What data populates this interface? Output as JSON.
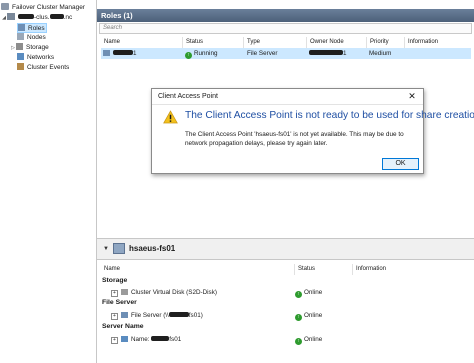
{
  "tree": {
    "root_label": "Failover Cluster Manager",
    "cluster_label_visible": "-clus.",
    "cluster_label_suffix": ".nc",
    "items": [
      {
        "label": "Roles"
      },
      {
        "label": "Nodes"
      },
      {
        "label": "Storage"
      },
      {
        "label": "Networks"
      },
      {
        "label": "Cluster Events"
      }
    ]
  },
  "roles_pane": {
    "title": "Roles (1)",
    "search_placeholder": "Search",
    "columns": [
      "Name",
      "Status",
      "Type",
      "Owner Node",
      "Priority",
      "Information"
    ],
    "row": {
      "name_suffix": "1",
      "status": "Running",
      "type": "File Server",
      "owner_suffix": "1",
      "priority": "Medium",
      "information": ""
    }
  },
  "dialog": {
    "title": "Client Access Point",
    "close_glyph": "✕",
    "heading": "The Client Access Point is not ready to be used for share creation.",
    "message": "The Client Access Point 'hsaeus-fs01' is not yet available. This may be due to network propagation delays, please try again later.",
    "ok_label": "OK"
  },
  "detail_pane": {
    "title": "hsaeus-fs01",
    "columns": [
      "Name",
      "Status",
      "Information"
    ],
    "groups": [
      {
        "label": "Storage",
        "items": [
          {
            "name": "Cluster Virtual Disk (S2D-Disk)",
            "status": "Online"
          }
        ]
      },
      {
        "label": "File Server",
        "items": [
          {
            "name_prefix": "File Server (\\\\",
            "name_suffix": "fs01)",
            "status": "Online"
          }
        ]
      },
      {
        "label": "Server Name",
        "items": [
          {
            "name_prefix": "Name: ",
            "name_suffix": "fs01",
            "status": "Online"
          }
        ]
      }
    ]
  },
  "colors": {
    "header_blue": "#4c6079",
    "warning_yellow": "#f3c11b",
    "dialog_heading": "#1f4fa3",
    "online_green": "#2e9b2e"
  }
}
